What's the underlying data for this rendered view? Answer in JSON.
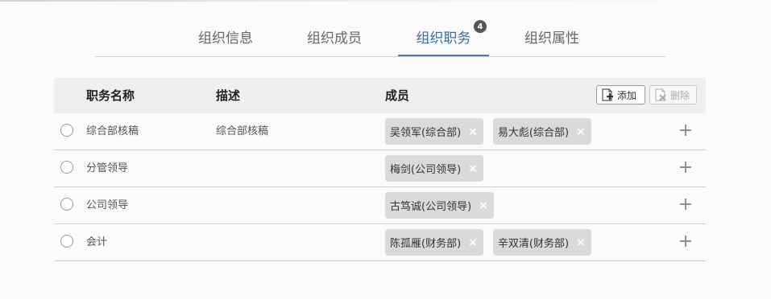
{
  "tabs": [
    {
      "label": "组织信息"
    },
    {
      "label": "组织成员"
    },
    {
      "label": "组织职务",
      "badge": "4",
      "active": true
    },
    {
      "label": "组织属性"
    }
  ],
  "table": {
    "headers": {
      "name": "职务名称",
      "desc": "描述",
      "members": "成员"
    },
    "add_label": "添加",
    "delete_label": "删除",
    "rows": [
      {
        "name": "综合部核稿",
        "desc": "综合部核稿",
        "members": [
          "吴领军(综合部)",
          "易大彪(综合部)"
        ]
      },
      {
        "name": "分管领导",
        "desc": "",
        "members": [
          "梅剑(公司领导)"
        ]
      },
      {
        "name": "公司领导",
        "desc": "",
        "members": [
          "古笃诚(公司领导)"
        ]
      },
      {
        "name": "会计",
        "desc": "",
        "members": [
          "陈孤雁(财务部)",
          "辛双清(财务部)"
        ]
      }
    ],
    "remove_glyph": "×",
    "add_row_glyph": "+"
  }
}
